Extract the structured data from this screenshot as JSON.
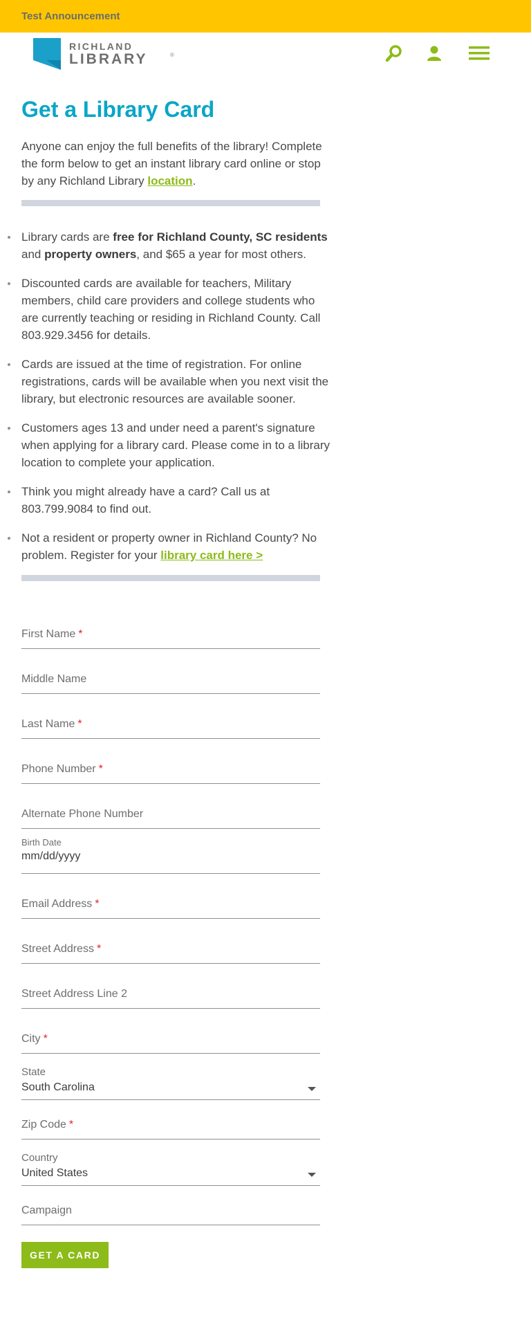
{
  "announcement": "Test Announcement",
  "header": {
    "logo_line1": "RICHLAND",
    "logo_line2": "LIBRARY",
    "logo_reg": "®",
    "icons": [
      "search-icon",
      "user-icon",
      "menu-icon"
    ],
    "accent": "#8dbb19",
    "brand": "#0aa6c7"
  },
  "page": {
    "title": "Get a Library Card",
    "intro_text": "Anyone can enjoy the full benefits of the library! Complete the form below to get an instant library card online or stop by any Richland Library ",
    "intro_link": "location",
    "intro_end": "."
  },
  "bullets": {
    "b1_a": "Library cards are ",
    "b1_bold1": "free for Richland County, SC residents",
    "b1_b": " and ",
    "b1_bold2": "property owners",
    "b1_c": ", and $65 a year for most others.",
    "b2": "Discounted cards are available for teachers, Military members, child care providers and college students who are currently teaching or residing in Richland County. Call 803.929.3456 for details.",
    "b3": "Cards are issued at the time of registration. For online registrations, cards will be available when you next visit the library, but electronic resources are available sooner.",
    "b4": "Customers ages 13 and under need a parent's signature when applying for a library card. Please come in to a library location to complete your application.",
    "b5": "Think you might already have a card? Call us at 803.799.9084 to find out.",
    "b6_a": "Not a resident or property owner in Richland County? No problem. Register for your ",
    "b6_link": "library card here >"
  },
  "form": {
    "required_mark": "*",
    "first_name": "First Name",
    "middle_name": "Middle Name",
    "last_name": "Last Name",
    "phone": "Phone Number",
    "alt_phone": "Alternate Phone Number",
    "birth_label": "Birth Date",
    "birth_placeholder": "mm/dd/yyyy",
    "email": "Email Address",
    "street": "Street Address",
    "street2": "Street Address Line 2",
    "city": "City",
    "state_label": "State",
    "state_value": "South Carolina",
    "zip": "Zip Code",
    "country_label": "Country",
    "country_value": "United States",
    "campaign": "Campaign",
    "submit": "GET A CARD"
  }
}
